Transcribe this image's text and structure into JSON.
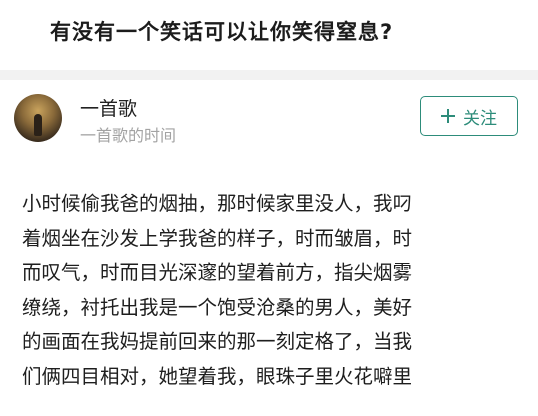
{
  "question": {
    "title": "有没有一个笑话可以让你笑得窒息?"
  },
  "author": {
    "name": "一首歌",
    "subtitle": "一首歌的时间"
  },
  "follow_button": {
    "label": "关注"
  },
  "answer": {
    "lines": [
      "小时候偷我爸的烟抽，那时候家里没人，我叼",
      "着烟坐在沙发上学我爸的样子，时而皱眉，时",
      "而叹气，时而目光深邃的望着前方，指尖烟雾",
      "缭绕，衬托出我是一个饱受沧桑的男人，美好",
      "的画面在我妈提前回来的那一刻定格了，当我",
      "们俩四目相对，她望着我，眼珠子里火花噼里"
    ]
  },
  "colors": {
    "accent": "#2d8c7a",
    "divider": "#f2f2f2",
    "muted_text": "#a3a3a3"
  },
  "icons": {
    "follow": "plus-icon",
    "avatar": "avatar-image"
  }
}
